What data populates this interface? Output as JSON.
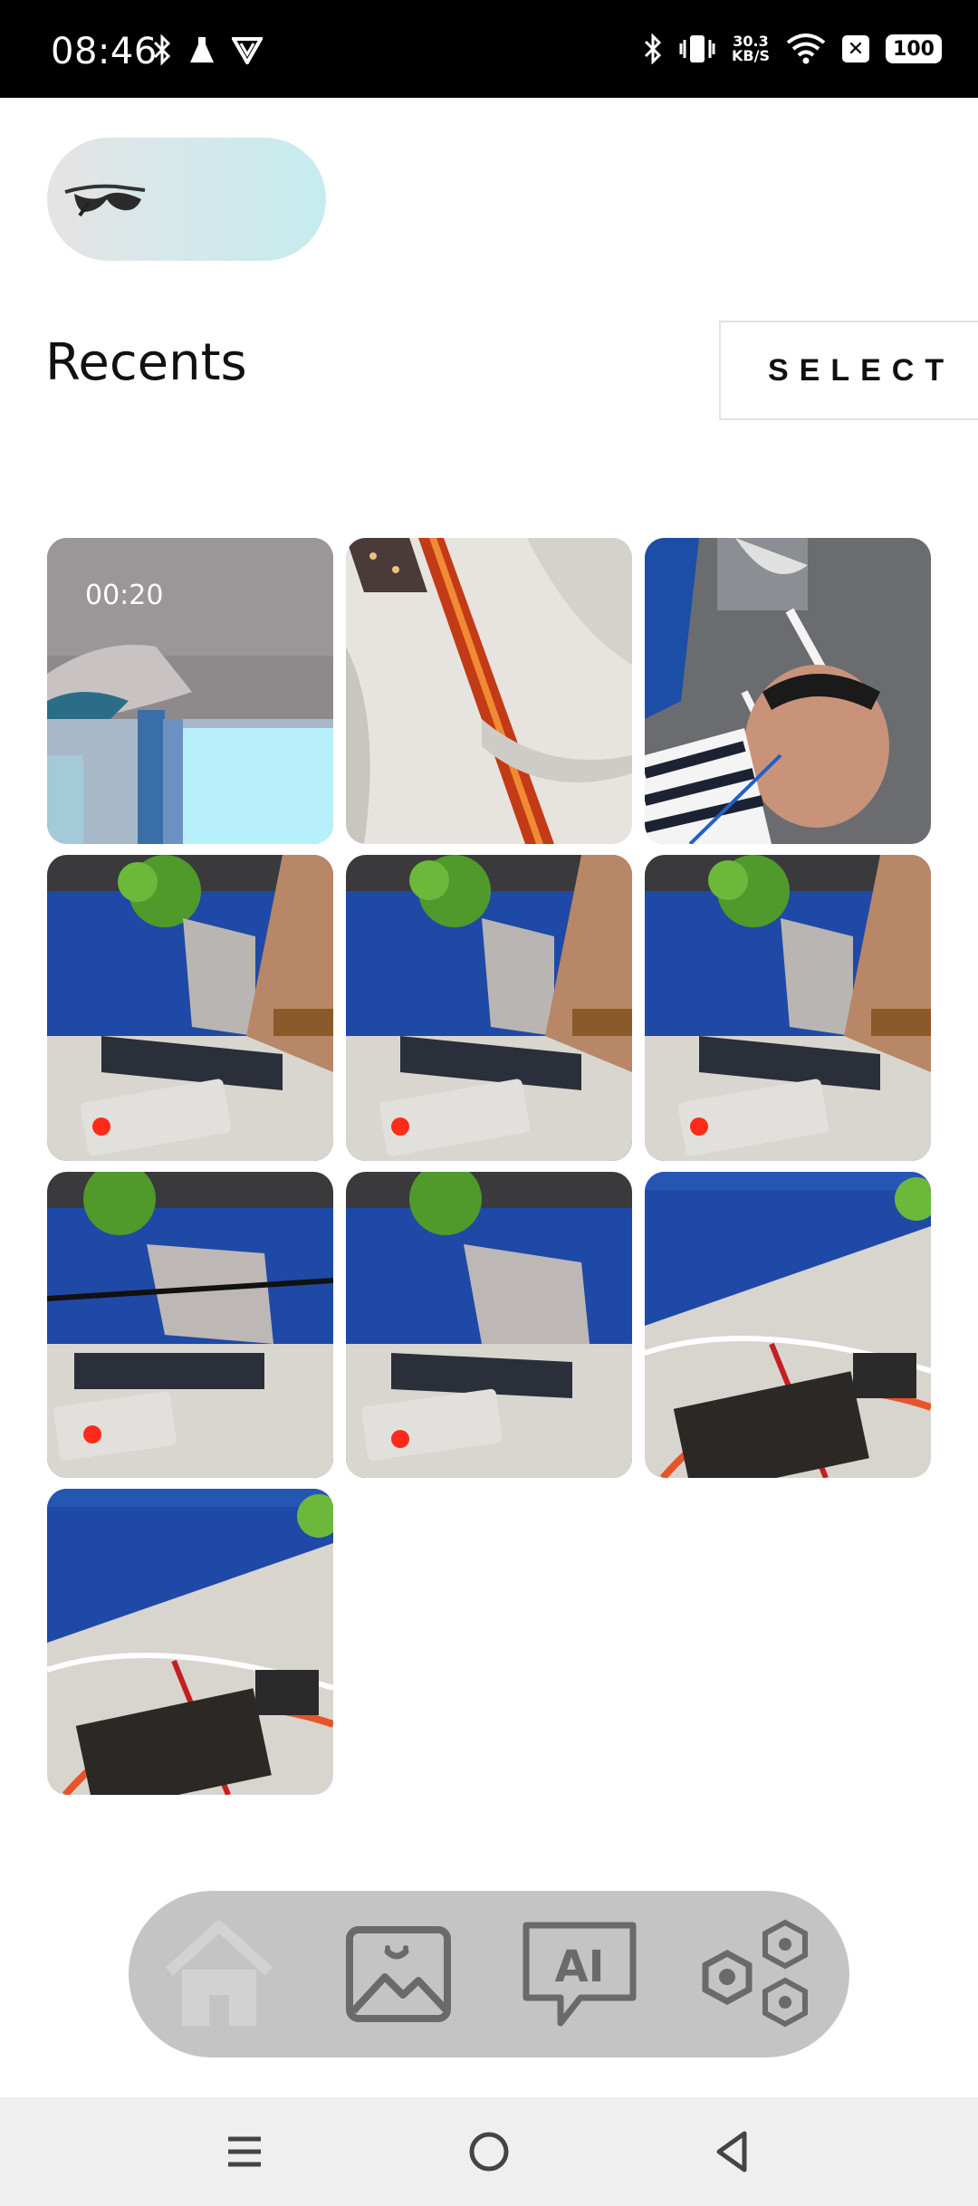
{
  "status_bar": {
    "time": "08:46",
    "net_speed_value": "30.3",
    "net_speed_unit": "KB/S",
    "battery": "100",
    "icons": [
      "bluetooth-icon",
      "flask-icon",
      "vpn-icon",
      "bluetooth-icon",
      "vibrate-icon",
      "wifi-icon",
      "close-box-icon",
      "battery-icon"
    ]
  },
  "device": {
    "icon": "glasses-icon"
  },
  "header": {
    "title": "Recents",
    "select_label": "SELECT"
  },
  "gallery": {
    "items": [
      {
        "type": "video",
        "duration": "00:20"
      },
      {
        "type": "photo"
      },
      {
        "type": "photo"
      },
      {
        "type": "photo"
      },
      {
        "type": "photo"
      },
      {
        "type": "photo"
      },
      {
        "type": "photo"
      },
      {
        "type": "photo"
      },
      {
        "type": "photo"
      },
      {
        "type": "photo"
      }
    ]
  },
  "bottom_nav": {
    "items": [
      {
        "icon": "home-icon",
        "active": false
      },
      {
        "icon": "gallery-icon",
        "active": true
      },
      {
        "icon": "ai-chat-icon",
        "label": "AI",
        "active": true
      },
      {
        "icon": "apps-hexagon-icon",
        "active": true
      }
    ]
  },
  "system_nav": {
    "icons": [
      "menu-icon",
      "home-circle-icon",
      "back-icon"
    ]
  },
  "colors": {
    "status_bar_bg": "#000000",
    "nav_bg": "#c4c4c4",
    "pill_gradient_end": "#c6ecee"
  }
}
